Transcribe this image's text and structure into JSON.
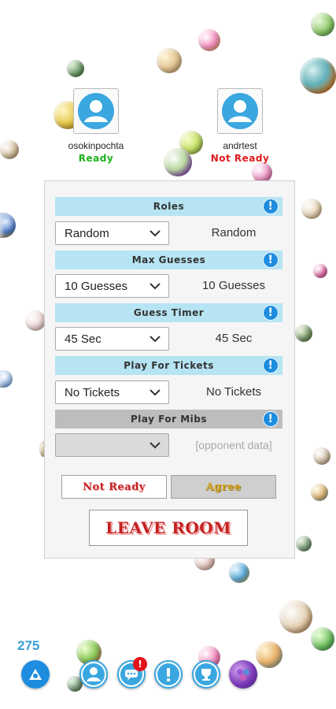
{
  "players": [
    {
      "name": "osokinpochta",
      "status": "Ready",
      "status_color": "#1db21d"
    },
    {
      "name": "andrtest",
      "status": "Not Ready",
      "status_color": "#e01b1b"
    }
  ],
  "settings": [
    {
      "title": "Roles",
      "selected": "Random",
      "opponent_value": "Random"
    },
    {
      "title": "Max Guesses",
      "selected": "10 Guesses",
      "opponent_value": "10 Guesses"
    },
    {
      "title": "Guess Timer",
      "selected": "45 Sec",
      "opponent_value": "45 Sec"
    },
    {
      "title": "Play For Tickets",
      "selected": "No Tickets",
      "opponent_value": "No Tickets"
    },
    {
      "title": "Play For Mibs",
      "selected": "",
      "opponent_value": "[opponent data]"
    }
  ],
  "buttons": {
    "not_ready": "Not Ready",
    "agree": "Agree",
    "leave_room": "LEAVE ROOM"
  },
  "footer": {
    "coins": "275",
    "notification_badge": "!",
    "nav_icons": [
      "marble-shooter-icon",
      "profile-icon",
      "chat-icon",
      "info-icon",
      "trophy-icon",
      "marble-collection-icon"
    ]
  },
  "colors": {
    "header_blue": "#b6e4f3",
    "accent_blue": "#1e8de0",
    "ready_green": "#1db21d",
    "not_ready_red": "#e01b1b"
  }
}
